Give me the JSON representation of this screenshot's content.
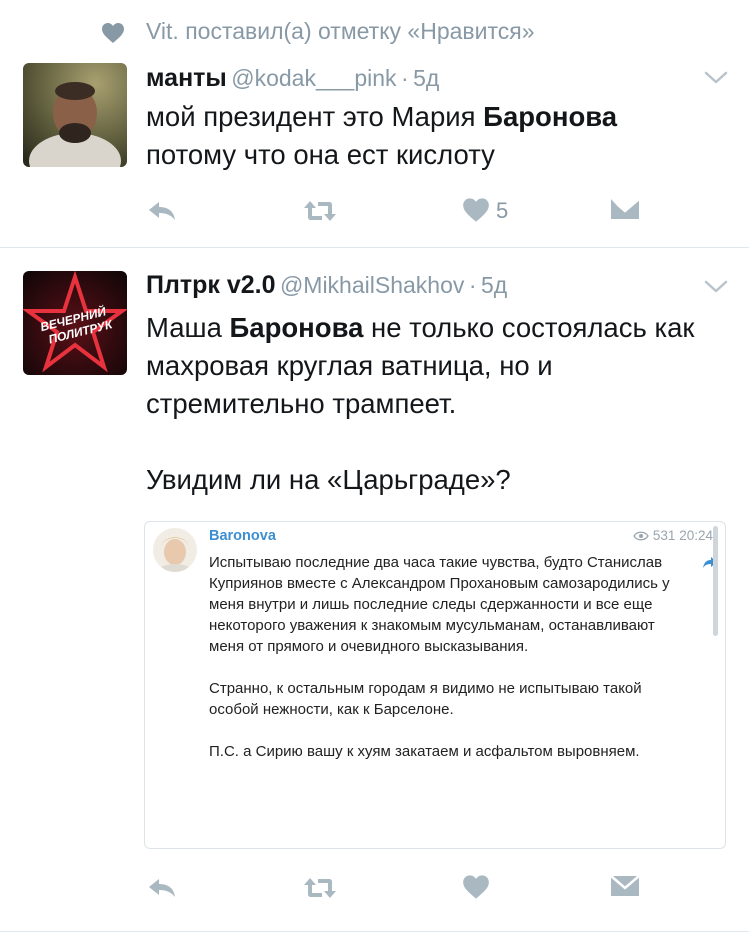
{
  "social_context": {
    "text": "Vit. поставил(а) отметку «Нравится»"
  },
  "tweets": [
    {
      "name": "манты",
      "handle": "@kodak___pink",
      "separator": "·",
      "time": "5д",
      "text_parts": [
        "мой президент это Мария ",
        "Баронова",
        "\nпотому что она ест кислоту"
      ],
      "like_count": "5"
    },
    {
      "name": "Плтрк v2.0",
      "handle": "@MikhailShakhov",
      "separator": "·",
      "time": "5д",
      "avatar_text": "ВЕЧЕРНИЙ ПОЛИТРУК",
      "text_parts": [
        "Маша ",
        "Баронова",
        " не только состоялась как махровая круглая ватница, но и стремительно трампеет."
      ],
      "text_para2": "Увидим ли на «Царьграде»?",
      "embed": {
        "author": "Baronova",
        "views": "531",
        "time": "20:24",
        "paragraphs": [
          "Испытываю последние два часа такие чувства, будто Станислав Куприянов вместе с Александром Прохановым самозародились у меня внутри и лишь последние следы сдержанности и все еще некоторого уважения к знакомым мусульманам, останавливают меня от прямого и очевидного высказывания.",
          "Странно, к остальным городам я видимо не испытываю такой особой нежности, как к Барселоне.",
          "П.С. а Сирию вашу к хуям закатаем и асфальтом выровняем."
        ]
      }
    }
  ],
  "colors": {
    "muted": "#8899a6",
    "text": "#14171a",
    "link": "#3d8fd1",
    "divider": "#e1e8ed"
  }
}
